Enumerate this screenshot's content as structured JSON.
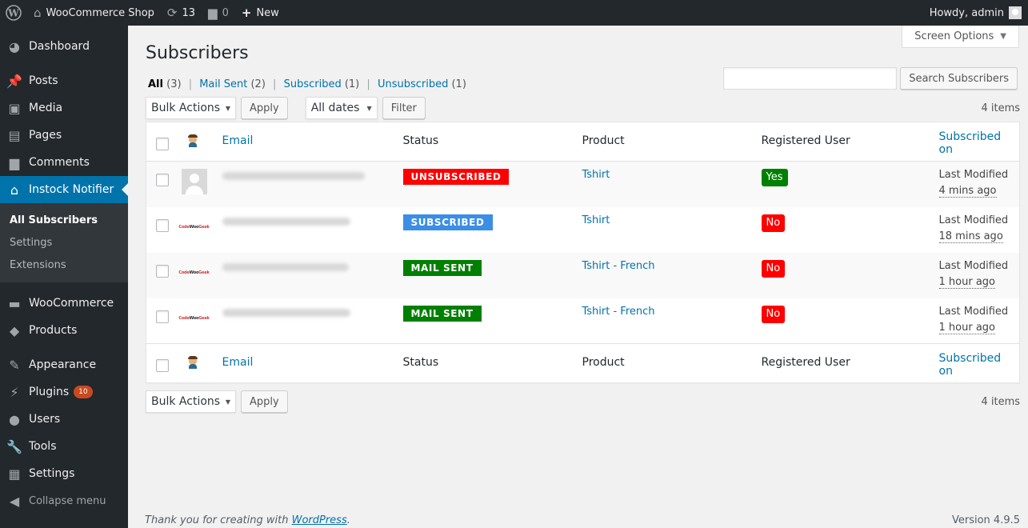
{
  "admin_bar": {
    "site_name": "WooCommerce Shop",
    "updates_count": "13",
    "comments_count": "0",
    "new_label": "New",
    "greeting": "Howdy, admin"
  },
  "sidebar": {
    "items": [
      {
        "label": "Dashboard",
        "icon": "dashboard-icon"
      },
      {
        "label": "Posts",
        "icon": "pin-icon"
      },
      {
        "label": "Media",
        "icon": "media-icon"
      },
      {
        "label": "Pages",
        "icon": "pages-icon"
      },
      {
        "label": "Comments",
        "icon": "comment-icon"
      },
      {
        "label": "Instock Notifier",
        "icon": "store-icon"
      },
      {
        "label": "WooCommerce",
        "icon": "woo-icon"
      },
      {
        "label": "Products",
        "icon": "box-icon"
      },
      {
        "label": "Appearance",
        "icon": "brush-icon"
      },
      {
        "label": "Plugins",
        "icon": "plug-icon"
      },
      {
        "label": "Users",
        "icon": "user-icon"
      },
      {
        "label": "Tools",
        "icon": "wrench-icon"
      },
      {
        "label": "Settings",
        "icon": "settings-icon"
      }
    ],
    "submenu": [
      "All Subscribers",
      "Settings",
      "Extensions"
    ],
    "plugins_badge": "10",
    "collapse_label": "Collapse menu"
  },
  "screen_options": "Screen Options",
  "page_title": "Subscribers",
  "views": {
    "all": "All",
    "all_count": "(3)",
    "mail_sent": "Mail Sent",
    "mail_sent_count": "(2)",
    "subscribed": "Subscribed",
    "subscribed_count": "(1)",
    "unsubscribed": "Unsubscribed",
    "unsubscribed_count": "(1)"
  },
  "search": {
    "placeholder": "",
    "button": "Search Subscribers"
  },
  "tablenav": {
    "bulk_actions": "Bulk Actions",
    "apply": "Apply",
    "all_dates": "All dates",
    "filter": "Filter",
    "items_count": "4 items"
  },
  "table": {
    "columns": [
      "Email",
      "Status",
      "Product",
      "Registered User",
      "Subscribed on"
    ],
    "rows": [
      {
        "status": "UNSUBSCRIBED",
        "status_color": "#ff0000",
        "product": "Tshirt",
        "registered": "Yes",
        "registered_color": "#008000",
        "modified_label": "Last Modified",
        "modified_ago": "4 mins ago"
      },
      {
        "status": "SUBSCRIBED",
        "status_color": "#3a8ee6",
        "product": "Tshirt",
        "registered": "No",
        "registered_color": "#ff0000",
        "modified_label": "Last Modified",
        "modified_ago": "18 mins ago"
      },
      {
        "status": "MAIL SENT",
        "status_color": "#008000",
        "product": "Tshirt - French",
        "registered": "No",
        "registered_color": "#ff0000",
        "modified_label": "Last Modified",
        "modified_ago": "1 hour ago"
      },
      {
        "status": "MAIL SENT",
        "status_color": "#008000",
        "product": "Tshirt - French",
        "registered": "No",
        "registered_color": "#ff0000",
        "modified_label": "Last Modified",
        "modified_ago": "1 hour ago"
      }
    ]
  },
  "footer": {
    "thanks_prefix": "Thank you for creating with",
    "wordpress_link": "WordPress",
    "thanks_suffix": ".",
    "version": "Version 4.9.5"
  }
}
